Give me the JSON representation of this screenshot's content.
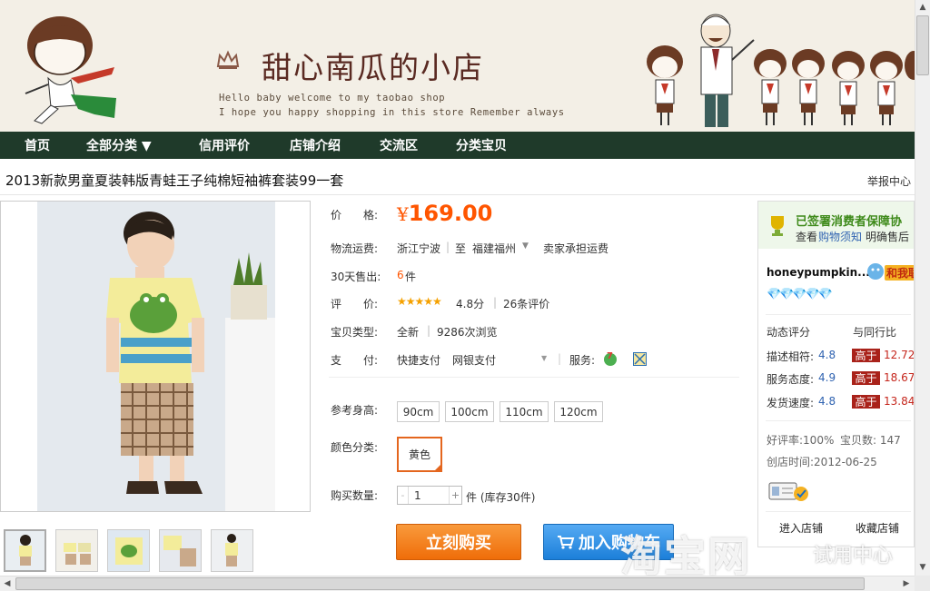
{
  "banner": {
    "shop_name": "甜心南瓜的小店",
    "slogan_line1": "Hello baby welcome to my taobao shop",
    "slogan_line2": "I hope you happy shopping in this store  Remember always"
  },
  "nav": {
    "items": [
      "首页",
      "全部分类 ▼",
      "信用评价",
      "店铺介绍",
      "交流区",
      "分类宝贝"
    ]
  },
  "product": {
    "title": "2013新款男童夏装韩版青蛙王子纯棉短袖裤套装99一套",
    "report_link": "举报中心",
    "price_label": "价　　格:",
    "currency": "¥",
    "price": "169.00",
    "shipping_label": "物流运费:",
    "shipping_from": "浙江宁波",
    "shipping_to_prefix": "至",
    "shipping_to": "福建福州",
    "shipping_note": "卖家承担运费",
    "sold_label": "30天售出:",
    "sold_count": "6",
    "sold_unit": "件",
    "rating_label": "评　　价:",
    "stars": "★★★★★",
    "rating_score": "4.8分",
    "rating_count": "26条评价",
    "type_label": "宝贝类型:",
    "type_value": "全新",
    "views": "9286次浏览",
    "pay_label": "支　　付:",
    "pay_method1": "快捷支付",
    "pay_method2": "网银支付",
    "service_label": "服务:",
    "size_label": "参考身高:",
    "sizes": [
      "90cm",
      "100cm",
      "110cm",
      "120cm"
    ],
    "color_label": "颜色分类:",
    "color_value": "黄色",
    "qty_label": "购买数量:",
    "qty_value": "1",
    "stock_text": "件 (库存30件)",
    "buy_now": "立刻购买",
    "add_cart": "加入购物车"
  },
  "seller": {
    "guarantee_title": "已签署消费者保障协",
    "guarantee_sub1": "查看",
    "guarantee_link": "购物须知",
    "guarantee_sub2": "明确售后",
    "name": "honeypumpkin...",
    "chat_label": "和我联",
    "diamonds": "💎💎💎💎💎",
    "dynamic_label": "动态评分",
    "compare_label": "与同行比",
    "scores": [
      {
        "label": "描述相符:",
        "value": "4.8",
        "badge": "高于",
        "pct": "12.72"
      },
      {
        "label": "服务态度:",
        "value": "4.9",
        "badge": "高于",
        "pct": "18.67"
      },
      {
        "label": "发货速度:",
        "value": "4.8",
        "badge": "高于",
        "pct": "13.84"
      }
    ],
    "praise": "好评率:100%",
    "item_count": "宝贝数: 147",
    "created": "创店时间:2012-06-25",
    "enter_shop": "进入店铺",
    "favorite_shop": "收藏店铺"
  },
  "watermark": {
    "main": "淘宝网",
    "sub": "试用中心"
  },
  "colors": {
    "price": "#ff5500",
    "nav_bg": "#1f3a2a",
    "buy": "#ef6d09",
    "cart": "#1c7fd9",
    "badge": "#a9221a"
  }
}
